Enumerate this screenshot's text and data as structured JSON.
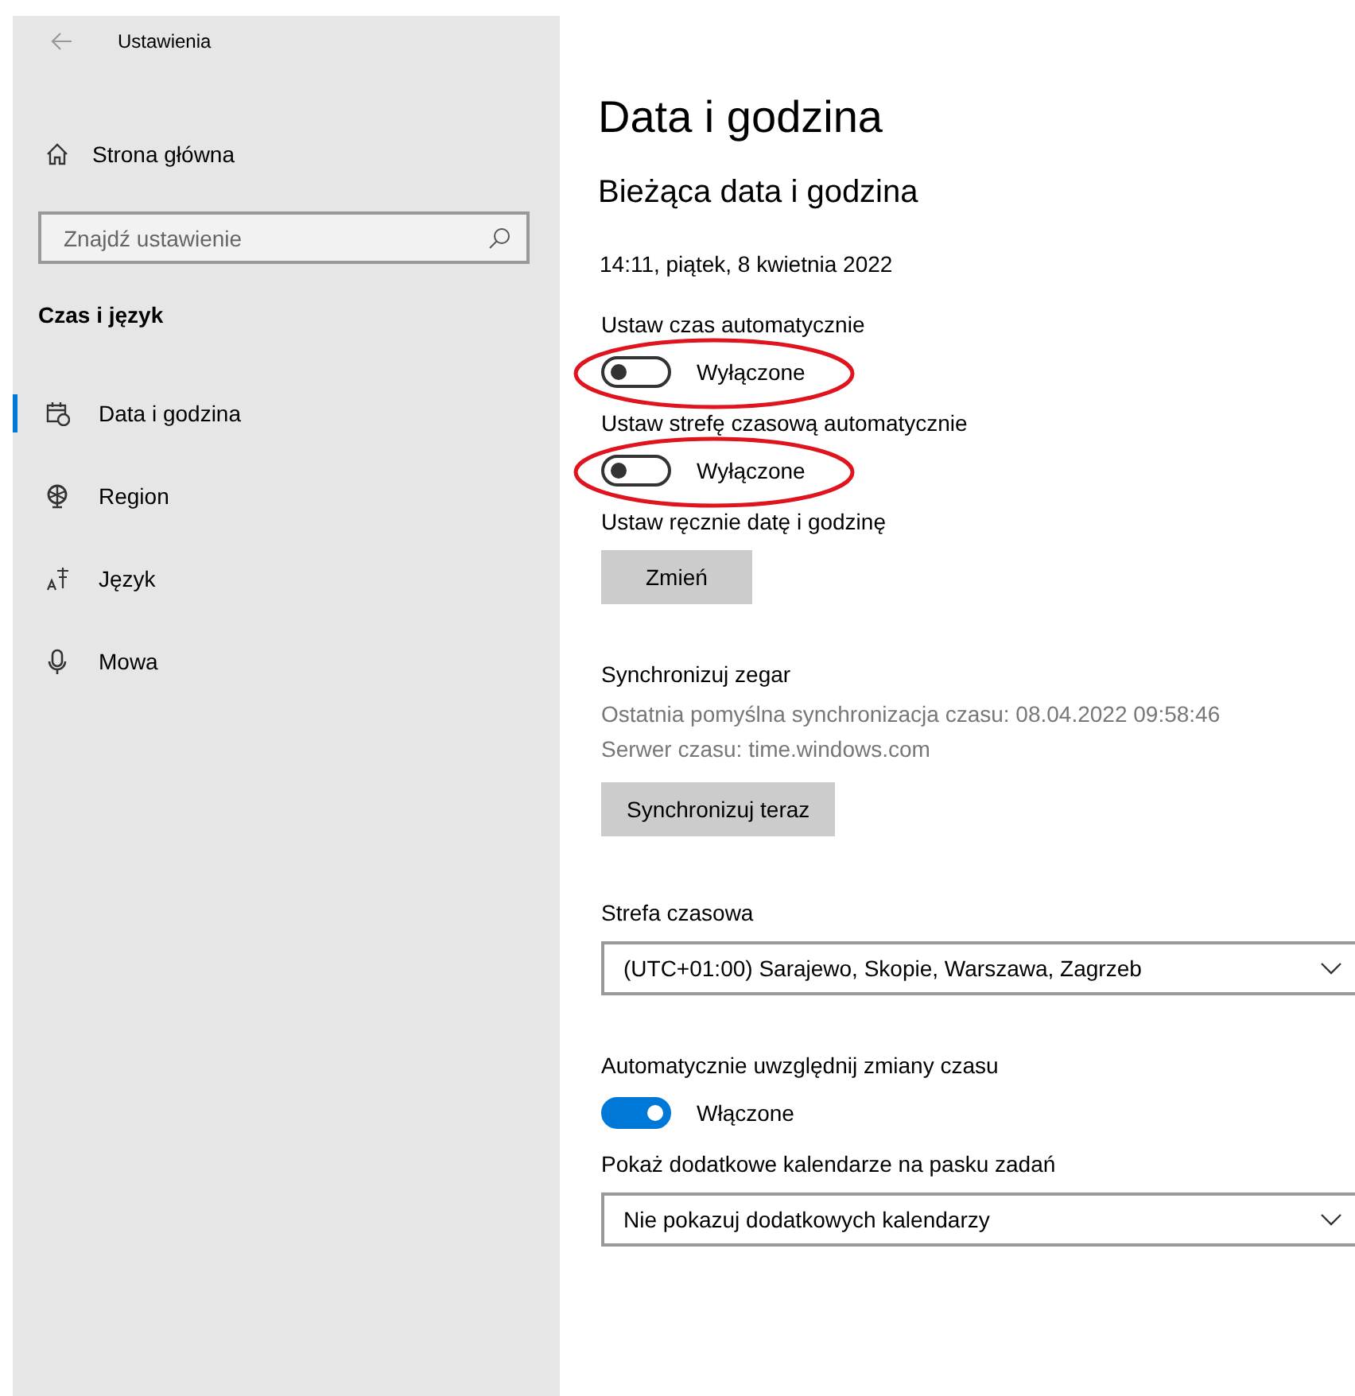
{
  "window": {
    "title": "Ustawienia"
  },
  "sidebar": {
    "home": "Strona główna",
    "search": {
      "placeholder": "Znajdź ustawienie"
    },
    "section": "Czas i język",
    "items": [
      {
        "label": "Data i godzina",
        "selected": true
      },
      {
        "label": "Region",
        "selected": false
      },
      {
        "label": "Język",
        "selected": false
      },
      {
        "label": "Mowa",
        "selected": false
      }
    ]
  },
  "page": {
    "title": "Data i godzina",
    "subtitle": "Bieżąca data i godzina",
    "current": "14:11, piątek, 8 kwietnia 2022",
    "settings": [
      {
        "kind": "toggle",
        "label": "Ustaw czas automatycznie",
        "on": false,
        "state": "Wyłączone",
        "highlighted": true
      },
      {
        "kind": "toggle",
        "label": "Ustaw strefę czasową automatycznie",
        "on": false,
        "state": "Wyłączone",
        "highlighted": true
      },
      {
        "kind": "button",
        "label": "Ustaw ręcznie datę i godzinę",
        "button": "Zmień"
      },
      {
        "kind": "sync",
        "label": "Synchronizuj zegar",
        "info": [
          "Ostatnia pomyślna synchronizacja czasu: 08.04.2022 09:58:46",
          "Serwer czasu: time.windows.com"
        ],
        "button": "Synchronizuj teraz"
      },
      {
        "kind": "select",
        "label": "Strefa czasowa",
        "value": "(UTC+01:00) Sarajewo, Skopie, Warszawa, Zagrzeb"
      },
      {
        "kind": "toggle",
        "label": "Automatycznie uwzględnij zmiany czasu",
        "on": true,
        "state": "Włączone",
        "highlighted": false
      },
      {
        "kind": "select",
        "label": "Pokaż dodatkowe kalendarze na pasku zadań",
        "value": "Nie pokazuj dodatkowych kalendarzy"
      }
    ]
  }
}
